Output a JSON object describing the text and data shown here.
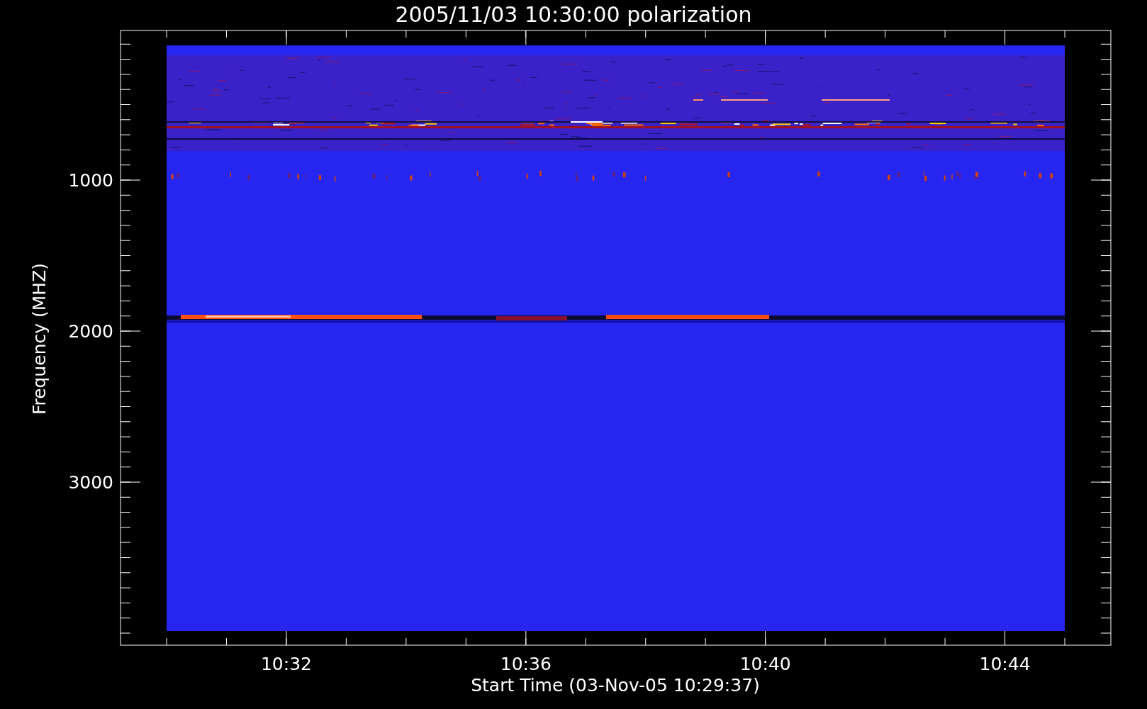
{
  "plot": {
    "title": "2005/11/03 10:30:00 polarization",
    "ylabel": "Frequency (MHZ)",
    "xlabel": "Start Time (03-Nov-05 10:29:37)",
    "yticks": [
      "1000",
      "2000",
      "3000"
    ],
    "xticks": [
      "10:32",
      "10:36",
      "10:40",
      "10:44"
    ]
  }
}
